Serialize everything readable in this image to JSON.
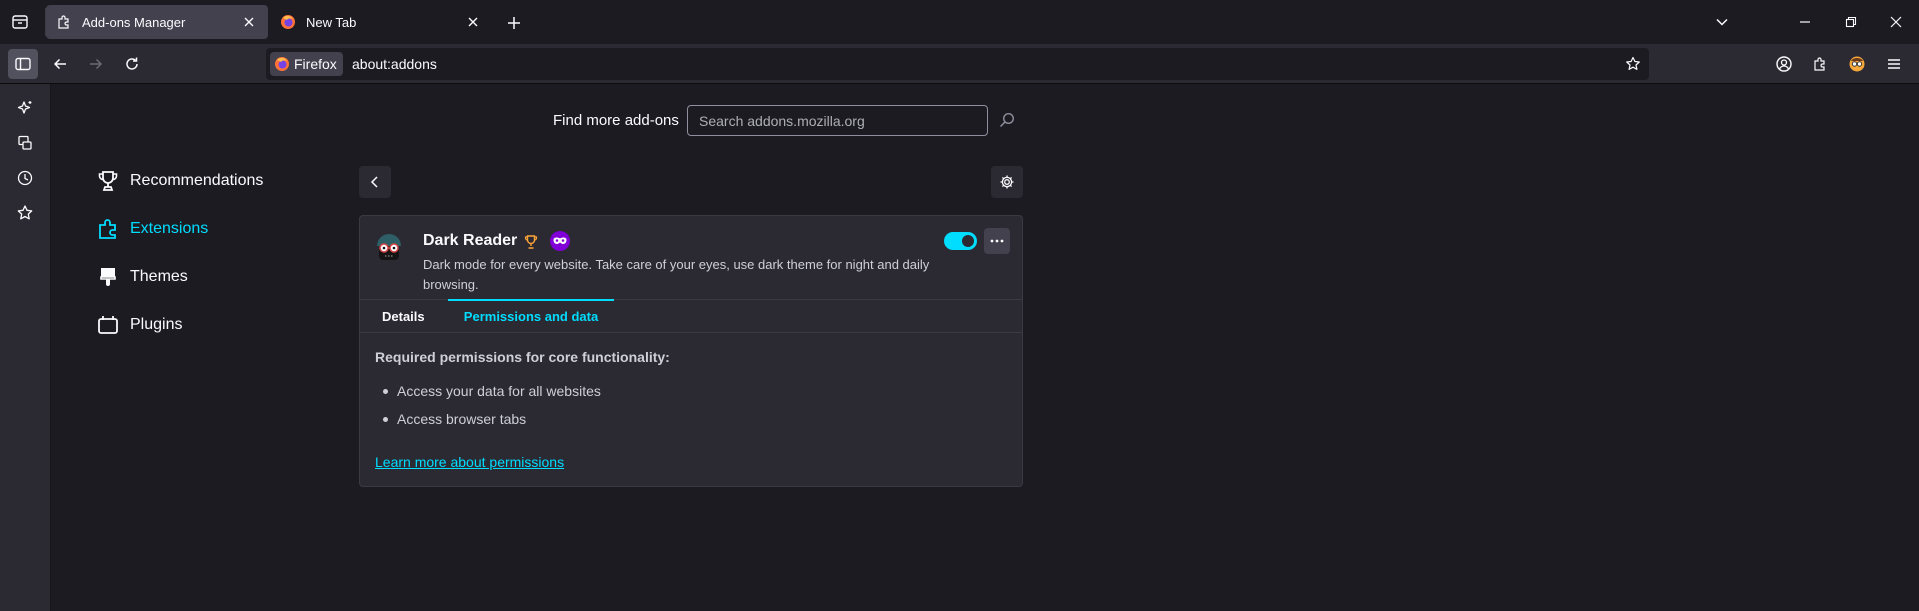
{
  "tabs": [
    {
      "title": "Add-ons Manager",
      "icon": "puzzle-icon",
      "active": true
    },
    {
      "title": "New Tab",
      "icon": "firefox-icon",
      "active": false
    }
  ],
  "urlbar": {
    "identity_label": "Firefox",
    "url": "about:addons"
  },
  "search": {
    "label": "Find more add-ons",
    "placeholder": "Search addons.mozilla.org"
  },
  "categories": [
    {
      "label": "Recommendations",
      "icon": "trophy-icon",
      "selected": false
    },
    {
      "label": "Extensions",
      "icon": "puzzle-icon",
      "selected": true
    },
    {
      "label": "Themes",
      "icon": "brush-icon",
      "selected": false
    },
    {
      "label": "Plugins",
      "icon": "plugin-icon",
      "selected": false
    }
  ],
  "addon": {
    "name": "Dark Reader",
    "description": "Dark mode for every website. Take care of your eyes, use dark theme for night and daily browsing.",
    "enabled": true,
    "tabs": [
      "Details",
      "Permissions and data"
    ],
    "selected_tab": "Permissions and data",
    "permissions_heading": "Required permissions for core functionality:",
    "permissions": [
      "Access your data for all websites",
      "Access browser tabs"
    ],
    "learn_more": "Learn more about permissions"
  },
  "colors": {
    "accent": "#00ddff",
    "background": "#1c1b22",
    "surface": "#2b2a33",
    "recommended_badge": "#ffa436",
    "private_badge": "#8000d7"
  }
}
